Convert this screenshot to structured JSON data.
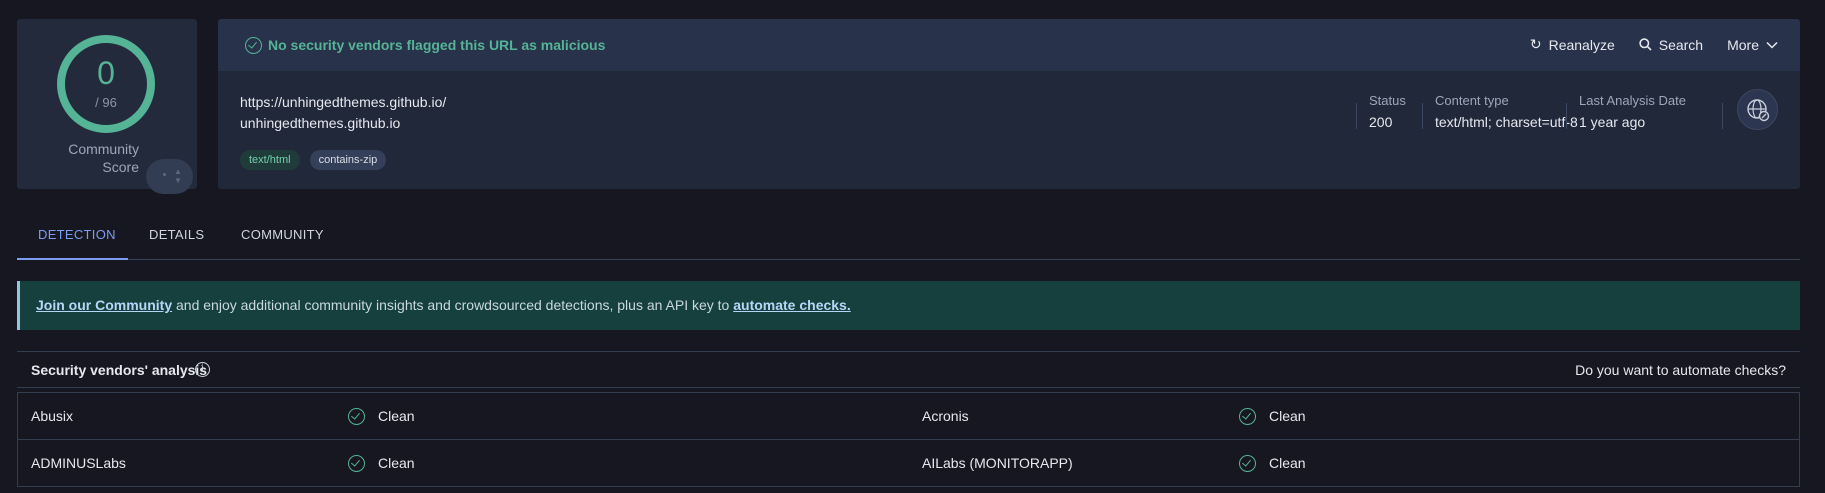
{
  "score": {
    "value": "0",
    "total": "/ 96",
    "community_label_line1": "Community",
    "community_label_line2": "Score",
    "accent_color": "#55b396"
  },
  "header": {
    "message": "No security vendors flagged this URL as malicious",
    "actions": {
      "reanalyze": "Reanalyze",
      "search": "Search",
      "more": "More"
    }
  },
  "url": {
    "full": "https://unhingedthemes.github.io/",
    "host": "unhingedthemes.github.io",
    "tags": [
      "text/html",
      "contains-zip"
    ]
  },
  "meta": {
    "status_label": "Status",
    "status_value": "200",
    "content_type_label": "Content type",
    "content_type_value": "text/html; charset=utf-8",
    "last_analysis_label": "Last Analysis Date",
    "last_analysis_value": "1 year ago"
  },
  "tabs": [
    {
      "label": "DETECTION",
      "active": true
    },
    {
      "label": "DETAILS",
      "active": false
    },
    {
      "label": "COMMUNITY",
      "active": false
    }
  ],
  "banner": {
    "link1": "Join our Community",
    "middle": " and enjoy additional community insights and crowdsourced detections, plus an API key to ",
    "link2": "automate checks."
  },
  "vendors": {
    "title": "Security vendors' analysis",
    "automate_question": "Do you want to automate checks?",
    "rows": [
      {
        "left_name": "Abusix",
        "left_status": "Clean",
        "right_name": "Acronis",
        "right_status": "Clean"
      },
      {
        "left_name": "ADMINUSLabs",
        "left_status": "Clean",
        "right_name": "AILabs (MONITORAPP)",
        "right_status": "Clean"
      }
    ]
  }
}
